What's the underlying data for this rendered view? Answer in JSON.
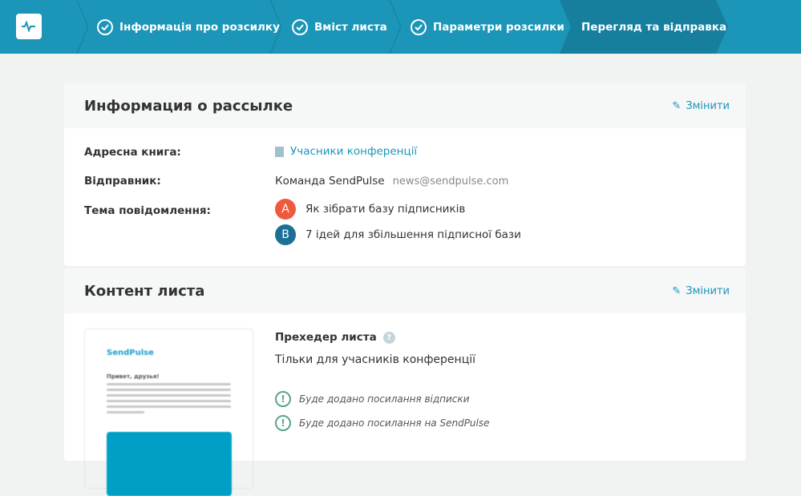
{
  "steps": [
    "Інформація про розсилку",
    "Вміст листа",
    "Параметри розсилки",
    "Перегляд та відправка"
  ],
  "info": {
    "title": "Информация о рассылке",
    "edit": "Змінити",
    "address_book_label": "Адресна книга:",
    "address_book": "Учасники конференції",
    "sender_label": "Відправник:",
    "sender_name": "Команда SendPulse",
    "sender_email": "news@sendpulse.com",
    "subject_label": "Тема повідомлення:",
    "subject_a": "Як зібрати базу підписників",
    "subject_b": "7 ідей для збільшення підписної бази",
    "badge_a": "A",
    "badge_b": "B",
    "badge_a_color": "#f05a3c",
    "badge_b_color": "#1d6f96"
  },
  "content": {
    "title": "Контент листа",
    "edit": "Змінити",
    "preheader_label": "Прехедер листа",
    "preheader": "Тільки для учасників конференції",
    "notice_unsub": "Буде додано посилання відписки",
    "notice_sp": "Буде додано посилання на SendPulse",
    "preview_logo": "SendPulse",
    "preview_heading": "Привет, друзья!"
  }
}
